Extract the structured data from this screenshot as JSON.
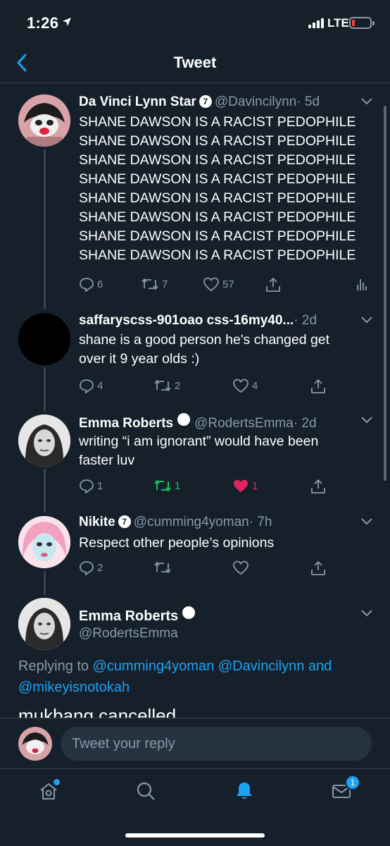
{
  "status_bar": {
    "time": "1:26",
    "network": "LTE",
    "battery_level": 0.1
  },
  "header": {
    "title": "Tweet"
  },
  "tweets": [
    {
      "name": "Da Vinci Lynn Star",
      "verified_badge": "7",
      "handle": "@Davincilynn",
      "time": "· 5d",
      "lines": [
        "SHANE DAWSON IS A RACIST PEDOPHILE",
        "SHANE DAWSON IS A RACIST PEDOPHILE",
        "SHANE DAWSON IS A RACIST PEDOPHILE",
        "SHANE DAWSON IS A RACIST PEDOPHILE",
        "SHANE DAWSON IS A RACIST PEDOPHILE",
        "SHANE DAWSON IS A RACIST PEDOPHILE",
        "SHANE DAWSON IS A RACIST PEDOPHILE",
        "SHANE DAWSON IS A RACIST PEDOPHILE"
      ],
      "replies": "6",
      "retweets": "7",
      "likes": "57"
    },
    {
      "name": "saffaryscss-901oao css-16my40...",
      "time": "· 2d",
      "lines": [
        "shane is a good person he's changed get",
        "over it 9 year olds :)"
      ],
      "replies": "4",
      "retweets": "2",
      "likes": "4"
    },
    {
      "name": "Emma Roberts",
      "handle": "@RodertsEmma",
      "time": "· 2d",
      "lines": [
        "writing “i am ignorant” would have been",
        "faster luv"
      ],
      "replies": "1",
      "retweets": "1",
      "likes": "1"
    },
    {
      "name": "Nikite",
      "verified_badge": "7",
      "handle": "@cumming4yoman",
      "time": "· 7h",
      "lines": [
        "Respect other people’s opinions"
      ],
      "replies": "2",
      "retweets": "",
      "likes": ""
    }
  ],
  "main_tweet": {
    "name": "Emma Roberts",
    "handle": "@RodertsEmma",
    "replying_prefix": "Replying to",
    "replying_links": [
      "@cumming4yoman",
      "@Davincilynn"
    ],
    "replying_and": "and",
    "replying_last": "@mikeyisnotokah",
    "text": "mukbang cancelled"
  },
  "reply_bar": {
    "placeholder": "Tweet your reply"
  },
  "tabbar": {
    "messages_badge": "1"
  },
  "colors": {
    "background": "#15202b",
    "accent": "#1da1f2",
    "muted": "#8899a6",
    "like": "#e0245e",
    "retweet": "#17bf63"
  },
  "icons": [
    "location-arrow-icon",
    "back-chevron-icon",
    "reply-icon",
    "retweet-icon",
    "like-icon",
    "share-icon",
    "analytics-icon",
    "home-icon",
    "search-icon",
    "notifications-bell-icon",
    "messages-envelope-icon"
  ]
}
